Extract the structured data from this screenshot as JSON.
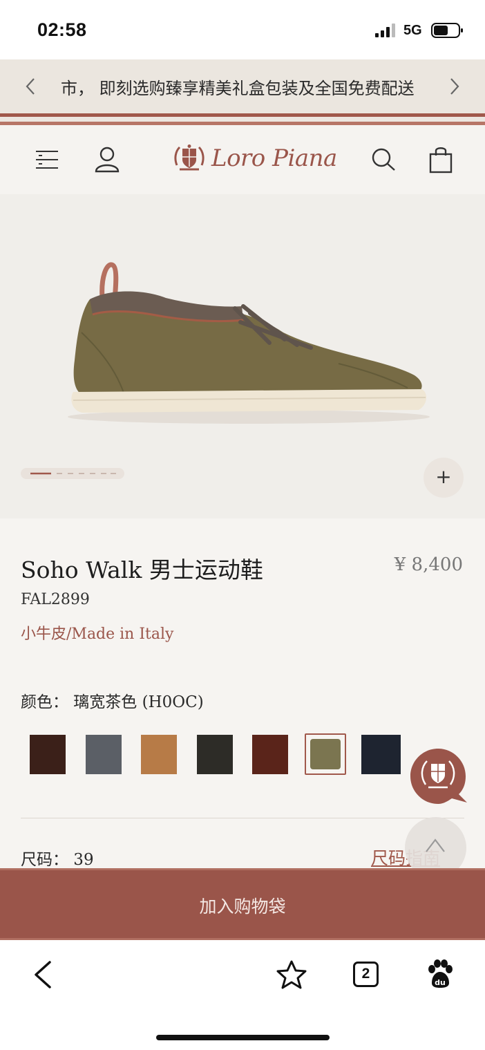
{
  "status_bar": {
    "time": "02:58",
    "network": "5G",
    "icons": [
      "signal-icon",
      "battery-icon"
    ]
  },
  "banner": {
    "text": "市， 即刻选购臻享精美礼盒包装及全国免费配送",
    "prev_icon": "chevron-left-icon",
    "next_icon": "chevron-right-icon"
  },
  "header": {
    "brand": "Loro Piana",
    "icons": [
      "menu-icon",
      "account-icon",
      "search-icon",
      "shopping-bag-icon"
    ]
  },
  "gallery": {
    "image": "olive suede sneaker with knit collar and cream sole",
    "slide_current": 1,
    "slide_total": 7,
    "zoom_label": "+"
  },
  "product": {
    "title": "Soho Walk 男士运动鞋",
    "price": "¥ 8,400",
    "sku": "FAL2899",
    "material": "小牛皮/Made in Italy",
    "color_label": "颜色： 璃宽茶色 (H0OC)",
    "swatches": [
      {
        "color": "#3b2019",
        "selected": false
      },
      {
        "color": "#5b5f66",
        "selected": false
      },
      {
        "color": "#b77b47",
        "selected": false
      },
      {
        "color": "#2d2c27",
        "selected": false
      },
      {
        "color": "#5a241a",
        "selected": false
      },
      {
        "color": "#7b7550",
        "selected": true
      },
      {
        "color": "#1e2430",
        "selected": false
      }
    ],
    "size_label": "尺码：  39",
    "size_guide": "尺码指南"
  },
  "cta": {
    "add_to_bag": "加入购物袋"
  },
  "browser": {
    "tab_count": "2",
    "icons": [
      "back-icon",
      "bookmark-star-icon",
      "tabs-icon",
      "baidu-paw-icon"
    ]
  },
  "colors": {
    "accent": "#9a554a",
    "banner_bg": "#ebe6df",
    "page_bg": "#f6f4f1"
  }
}
